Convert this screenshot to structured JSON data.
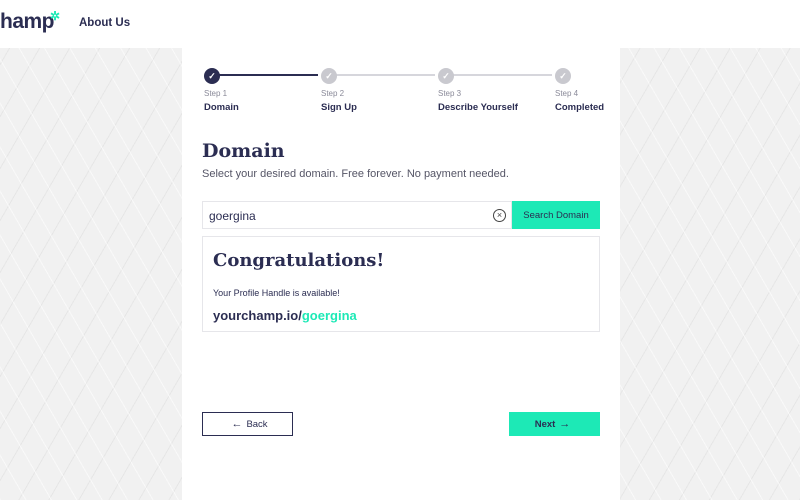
{
  "header": {
    "logo_text": "hamp",
    "logo_star": "✲",
    "nav_about": "About Us"
  },
  "stepper": {
    "steps": [
      {
        "num": "Step 1",
        "name": "Domain",
        "icon": "check-icon",
        "state": "active"
      },
      {
        "num": "Step 2",
        "name": "Sign Up",
        "icon": "check-icon",
        "state": "pending"
      },
      {
        "num": "Step 3",
        "name": "Describe Yourself",
        "icon": "check-icon",
        "state": "pending"
      },
      {
        "num": "Step 4",
        "name": "Completed",
        "icon": "check-icon",
        "state": "pending"
      }
    ]
  },
  "main": {
    "title": "Domain",
    "subtitle": "Select your desired domain. Free forever. No payment needed.",
    "search_value": "goergina",
    "search_button": "Search Domain",
    "clear_icon": "clear-circle-icon"
  },
  "result": {
    "heading": "Congratulations!",
    "message": "Your Profile Handle is available!",
    "url_prefix": "yourchamp.io/",
    "handle": "goergina"
  },
  "footer": {
    "back_label": "Back",
    "next_label": "Next",
    "back_icon": "arrow-left-icon",
    "next_icon": "arrow-right-icon"
  },
  "colors": {
    "primary": "#2b2d52",
    "accent": "#1de9b6",
    "inactive": "#c9c9cf"
  }
}
